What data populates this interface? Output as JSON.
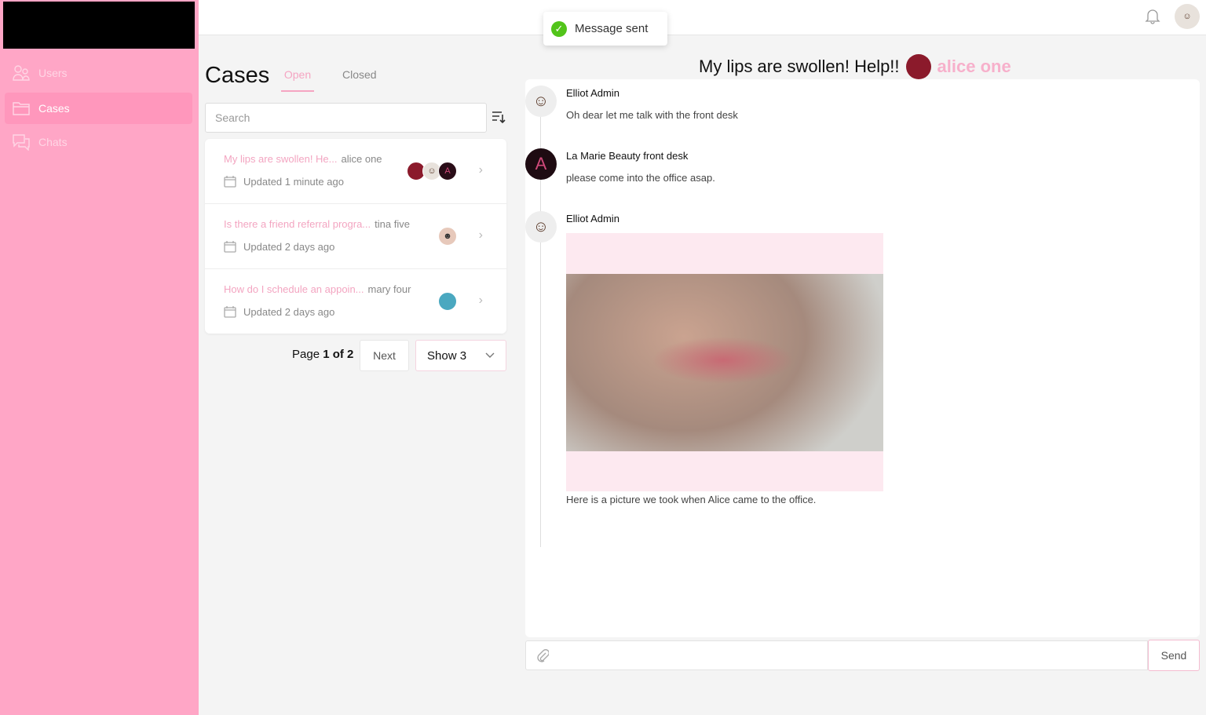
{
  "sidebar": {
    "items": [
      {
        "label": "Users",
        "icon": "users-icon"
      },
      {
        "label": "Cases",
        "icon": "folder-icon",
        "active": true
      },
      {
        "label": "Chats",
        "icon": "chat-icon"
      }
    ]
  },
  "toast": {
    "text": "Message sent",
    "color": "#52c41a"
  },
  "cases": {
    "title": "Cases",
    "tabs": [
      "Open",
      "Closed"
    ],
    "search_placeholder": "Search",
    "rows": [
      {
        "title": "My lips are swollen! He...",
        "user": "alice one",
        "updated": "Updated 1 minute ago"
      },
      {
        "title": "Is there a friend referral progra...",
        "user": "tina five",
        "updated": "Updated 2 days ago"
      },
      {
        "title": "How do I schedule an appoin...",
        "user": "mary four",
        "updated": "Updated 2 days ago"
      }
    ],
    "pager": {
      "prefix": "Page ",
      "current": "1 of 2",
      "next": "Next",
      "show": "Show 3"
    }
  },
  "chat": {
    "title": "My lips are swollen! Help!!",
    "user": "alice one",
    "messages": [
      {
        "name": "Elliot Admin",
        "body": "Oh dear let me talk with the front desk"
      },
      {
        "name": "La Marie Beauty front desk",
        "body": "please come into the office asap."
      },
      {
        "name": "Elliot Admin",
        "body": "Here is a picture we took when Alice came to the office."
      }
    ],
    "send": "Send"
  },
  "colors": {
    "sidebar": "#ffa6c6",
    "accent": "#f3a5c1"
  }
}
